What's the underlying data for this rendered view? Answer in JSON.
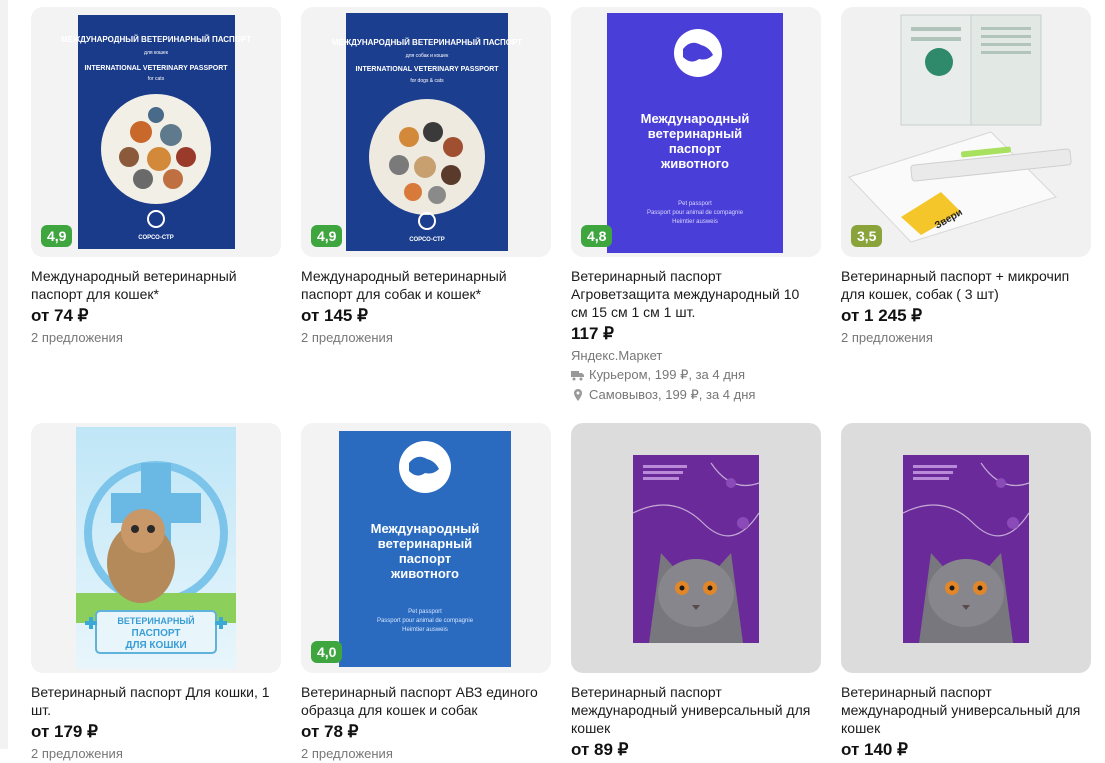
{
  "products": [
    {
      "title": "Международный ветеринарный паспорт для кошек*",
      "price": "от 74 ₽",
      "offers": "2 предложения",
      "rating": "4,9",
      "cover_title": "МЕЖДУНАРОДНЫЙ ВЕТЕРИНАРНЫЙ ПАСПОРТ",
      "cover_sub": "для кошек",
      "cover_en": "INTERNATIONAL VETERINARY PASSPORT",
      "cover_en_sub": "for cats",
      "brand": "СОРСО-СТР"
    },
    {
      "title": "Международный ветеринарный паспорт для собак и кошек*",
      "price": "от 145 ₽",
      "offers": "2 предложения",
      "rating": "4,9",
      "cover_title": "МЕЖДУНАРОДНЫЙ ВЕТЕРИНАРНЫЙ ПАСПОРТ",
      "cover_sub": "для собак и кошек",
      "cover_en": "INTERNATIONAL VETERINARY PASSPORT",
      "cover_en_sub": "for dogs & cats",
      "brand": "СОРСО-СТР"
    },
    {
      "title": "Ветеринарный паспорт Агроветзащита международный 10 см 15 см 1 см 1 шт.",
      "price": "117 ₽",
      "seller": "Яндекс.Маркет",
      "delivery_courier": "Курьером, 199 ₽, за 4 дня",
      "delivery_pickup": "Самовывоз, 199 ₽, за 4 дня",
      "rating": "4,8",
      "cover_title_1": "Международный",
      "cover_title_2": "ветеринарный",
      "cover_title_3": "паспорт",
      "cover_title_4": "животного",
      "cover_line_1": "Pet passport",
      "cover_line_2": "Passport pour animal de compagnie",
      "cover_line_3": "Heimtier ausweis"
    },
    {
      "title": "Ветеринарный паспорт + микрочип для кошек, собак ( 3 шт)",
      "price": "от 1 245 ₽",
      "offers": "2 предложения",
      "rating": "3,5",
      "brand": "Звери"
    },
    {
      "title": "Ветеринарный паспорт Для кошки, 1 шт.",
      "price": "от 179 ₽",
      "offers": "2 предложения",
      "cover_label_1": "ВЕТЕРИНАРНЫЙ",
      "cover_label_2": "ПАСПОРТ",
      "cover_label_3": "ДЛЯ КОШКИ"
    },
    {
      "title": "Ветеринарный паспорт АВЗ единого образца для кошек и собак",
      "price": "от 78 ₽",
      "offers": "2 предложения",
      "rating": "4,0",
      "cover_title_1": "Международный",
      "cover_title_2": "ветеринарный",
      "cover_title_3": "паспорт",
      "cover_title_4": "животного",
      "cover_line_1": "Pet passport",
      "cover_line_2": "Passport pour animal de compagnie",
      "cover_line_3": "Heimtier ausweis"
    },
    {
      "title": "Ветеринарный паспорт международный универсальный для кошек",
      "price": "от 89 ₽"
    },
    {
      "title": "Ветеринарный паспорт международный универсальный для кошек",
      "price": "от 140 ₽"
    }
  ],
  "colors": {
    "rating_high": "#3fa53f",
    "rating_mid": "#8aa33a",
    "navy_cover": "#1c3d8f",
    "violet_cover": "#4a3fd8",
    "blue_cover": "#2a6bc0",
    "purple_cover": "#6b2a9a"
  },
  "icons": {
    "courier": "truck-icon",
    "pickup": "location-pin-icon"
  }
}
